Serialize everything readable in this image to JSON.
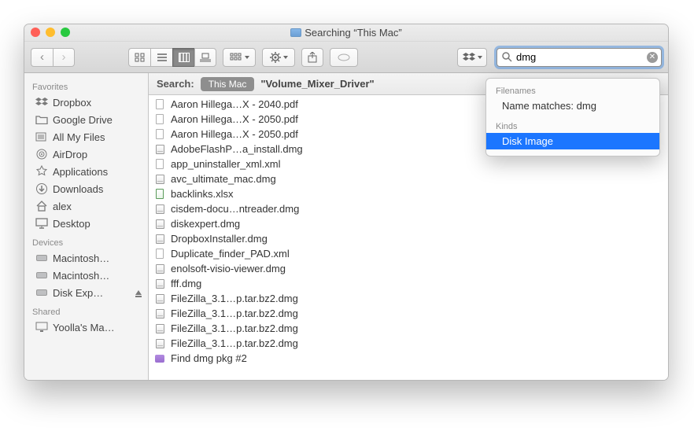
{
  "title": "Searching “This Mac”",
  "nav": {
    "back": "‹",
    "forward": "›"
  },
  "search": {
    "value": "dmg"
  },
  "scopebar": {
    "label": "Search:",
    "active": "This Mac",
    "folder": "\"Volume_Mixer_Driver\""
  },
  "sidebar": {
    "groups": [
      {
        "heading": "Favorites",
        "items": [
          {
            "icon": "dropbox",
            "label": "Dropbox"
          },
          {
            "icon": "folder",
            "label": "Google Drive"
          },
          {
            "icon": "allfiles",
            "label": "All My Files"
          },
          {
            "icon": "airdrop",
            "label": "AirDrop"
          },
          {
            "icon": "apps",
            "label": "Applications"
          },
          {
            "icon": "downloads",
            "label": "Downloads"
          },
          {
            "icon": "home",
            "label": "alex"
          },
          {
            "icon": "desktop",
            "label": "Desktop"
          }
        ]
      },
      {
        "heading": "Devices",
        "items": [
          {
            "icon": "hd",
            "label": "Macintosh…"
          },
          {
            "icon": "hd",
            "label": "Macintosh…"
          },
          {
            "icon": "hd",
            "label": "Disk Exp…",
            "eject": true
          }
        ]
      },
      {
        "heading": "Shared",
        "items": [
          {
            "icon": "monitor",
            "label": "Yoolla's Ma…"
          }
        ]
      }
    ]
  },
  "files": [
    {
      "kind": "doc",
      "name": "Aaron Hillega…X - 2040.pdf"
    },
    {
      "kind": "doc",
      "name": "Aaron Hillega…X - 2050.pdf"
    },
    {
      "kind": "doc",
      "name": "Aaron Hillega…X - 2050.pdf"
    },
    {
      "kind": "dmg",
      "name": "AdobeFlashP…a_install.dmg"
    },
    {
      "kind": "doc",
      "name": "app_uninstaller_xml.xml"
    },
    {
      "kind": "dmg",
      "name": "avc_ultimate_mac.dmg"
    },
    {
      "kind": "xls",
      "name": "backlinks.xlsx"
    },
    {
      "kind": "dmg",
      "name": "cisdem-docu…ntreader.dmg"
    },
    {
      "kind": "dmg",
      "name": "diskexpert.dmg"
    },
    {
      "kind": "dmg",
      "name": "DropboxInstaller.dmg"
    },
    {
      "kind": "doc",
      "name": "Duplicate_finder_PAD.xml"
    },
    {
      "kind": "dmg",
      "name": "enolsoft-visio-viewer.dmg"
    },
    {
      "kind": "dmg",
      "name": "fff.dmg"
    },
    {
      "kind": "dmg",
      "name": "FileZilla_3.1…p.tar.bz2.dmg"
    },
    {
      "kind": "dmg",
      "name": "FileZilla_3.1…p.tar.bz2.dmg"
    },
    {
      "kind": "dmg",
      "name": "FileZilla_3.1…p.tar.bz2.dmg"
    },
    {
      "kind": "dmg",
      "name": "FileZilla_3.1…p.tar.bz2.dmg"
    },
    {
      "kind": "smart",
      "name": "Find dmg pkg #2"
    }
  ],
  "suggestions": {
    "filenames_heading": "Filenames",
    "filenames_item": "Name matches: dmg",
    "kinds_heading": "Kinds",
    "kinds_item": "Disk Image"
  }
}
